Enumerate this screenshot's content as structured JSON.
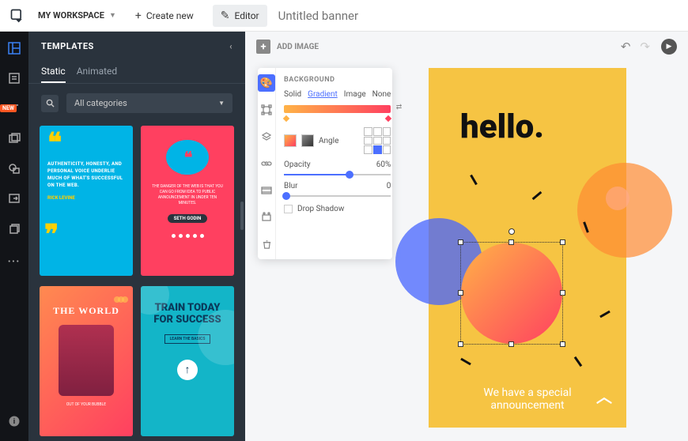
{
  "topbar": {
    "workspace_label": "MY WORKSPACE",
    "create_new": "Create new",
    "editor": "Editor",
    "title_placeholder": "Untitled banner"
  },
  "rail": {
    "new_badge": "NEW"
  },
  "templates": {
    "heading": "TEMPLATES",
    "tabs": {
      "static": "Static",
      "animated": "Animated"
    },
    "category": "All categories",
    "cards": {
      "c1": {
        "text": "AUTHENTICITY, HONESTY, AND PERSONAL VOICE UNDERLIE MUCH OF WHAT'S SUCCESSFUL ON THE WEB.",
        "author": "RICK LEVINE"
      },
      "c2": {
        "text": "THE DANGER OF THE WEB IS THAT YOU CAN GO FROM IDEA TO PUBLIC ANNOUNCEMENT IN UNDER TEN MINUTES.",
        "author": "SETH GODIN"
      },
      "c3": {
        "title": "THE WORLD",
        "sub": "OUT OF YOUR BUBBLE"
      },
      "c4": {
        "title": "TRAIN TODAY FOR SUCCESS",
        "button": "LEARN THE BASICS"
      }
    }
  },
  "canvas_bar": {
    "add_image": "ADD IMAGE"
  },
  "panel": {
    "heading": "BACKGROUND",
    "fill_tabs": {
      "solid": "Solid",
      "gradient": "Gradient",
      "image": "Image",
      "none": "None"
    },
    "angle_label": "Angle",
    "opacity_label": "Opacity",
    "opacity_value": "60%",
    "blur_label": "Blur",
    "blur_value": "0",
    "drop_shadow": "Drop Shadow",
    "gradient": {
      "start": "#ffb347",
      "end": "#ff4060"
    }
  },
  "banner": {
    "headline": "hello.",
    "footer_line1": "We have a special",
    "footer_line2": "announcement"
  }
}
